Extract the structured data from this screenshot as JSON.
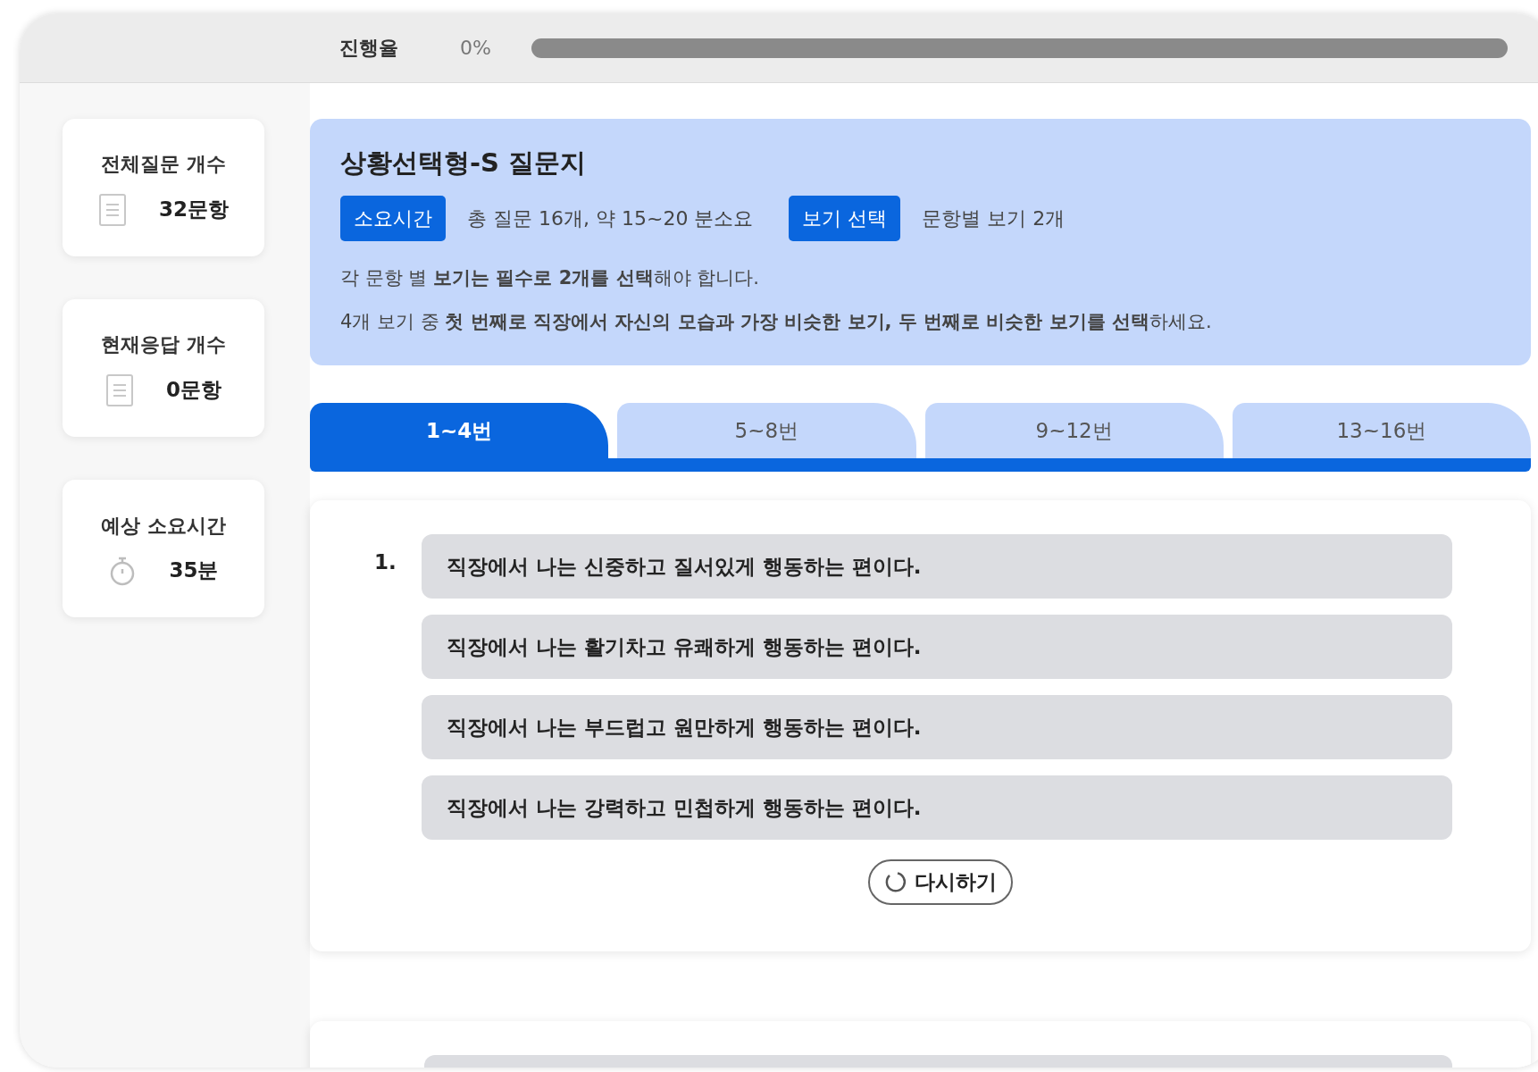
{
  "progress": {
    "label": "진행율",
    "value": "0%",
    "level": 0
  },
  "stats": [
    {
      "kind": "document",
      "label": "전체질문 개수",
      "value": "32문항"
    },
    {
      "kind": "document",
      "label": "현재응답 개수",
      "value": "0문항"
    },
    {
      "kind": "timer",
      "label": "예상 소요시간",
      "value": "35분"
    }
  ],
  "header": {
    "title": "상황선택형-S 질문지",
    "badges": [
      {
        "label": "소요시간",
        "text": "총 질문 16개, 약 15~20 분소요"
      },
      {
        "label": "보기 선택",
        "text": "문항별 보기 2개"
      }
    ],
    "instructions": [
      "각 문항 별 **보기는 필수로 2개를 선택**해야 합니다.",
      "4개 보기 중 **첫 번째로 직장에서 자신의 모습과 가장 비슷한 보기, 두 번째로 비슷한 보기를 선택**하세요."
    ]
  },
  "tabs": [
    {
      "label": "1~4번",
      "selected": true
    },
    {
      "label": "5~8번",
      "selected": false
    },
    {
      "label": "9~12번",
      "selected": false
    },
    {
      "label": "13~16번",
      "selected": false
    }
  ],
  "question": {
    "number": "1.",
    "options": [
      "직장에서 나는 신중하고 질서있게 행동하는 편이다.",
      "직장에서 나는 활기차고 유쾌하게 행동하는 편이다.",
      "직장에서 나는 부드럽고 원만하게 행동하는 편이다.",
      "직장에서 나는 강력하고 민첩하게 행동하는 편이다."
    ],
    "reset_button": "다시하기"
  }
}
